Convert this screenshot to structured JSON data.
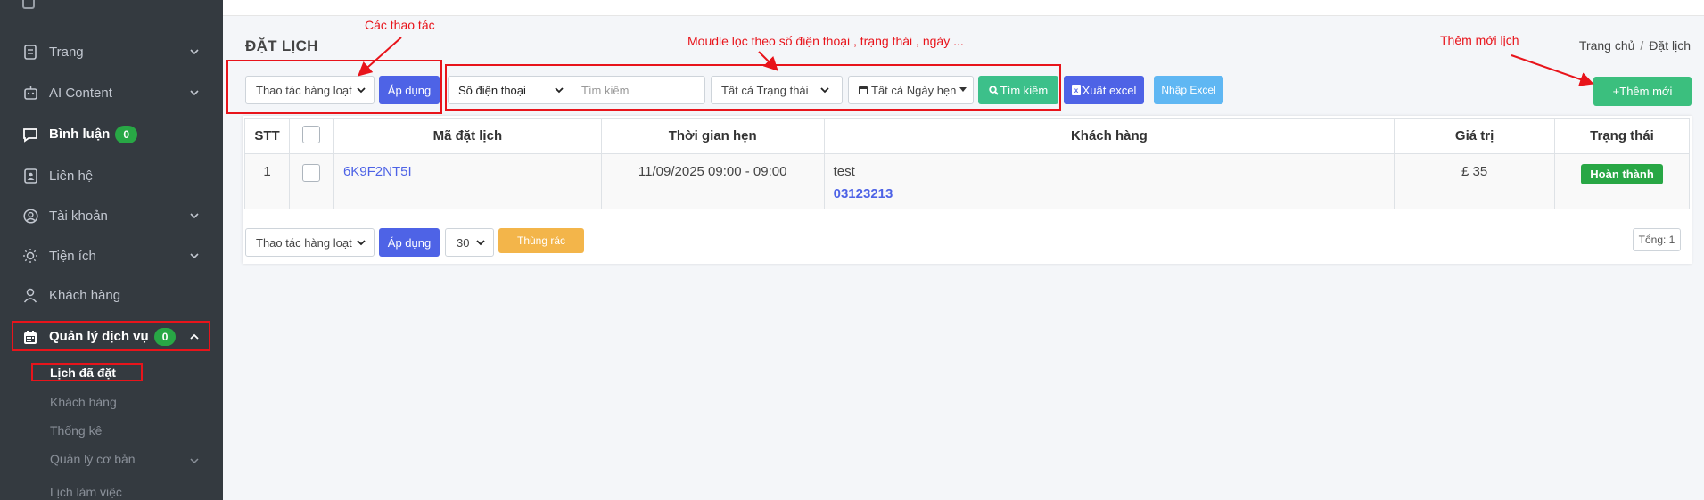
{
  "sidebar": {
    "items": [
      {
        "label": "Trang",
        "icon": "page-icon"
      },
      {
        "label": "AI Content",
        "icon": "robot-icon"
      },
      {
        "label": "Bình luận",
        "icon": "comment-icon",
        "badge": "0"
      },
      {
        "label": "Liên hệ",
        "icon": "contact-card-icon"
      },
      {
        "label": "Tài khoản",
        "icon": "user-circle-icon"
      },
      {
        "label": "Tiện ích",
        "icon": "sun-icon"
      },
      {
        "label": "Khách hàng",
        "icon": "user-icon"
      },
      {
        "label": "Quản lý dịch vụ",
        "icon": "calendar-icon",
        "badge": "0"
      }
    ],
    "subitems": [
      "Lịch đã đặt",
      "Khách hàng",
      "Thống kê",
      "Quản lý cơ bản",
      "Lịch làm việc"
    ]
  },
  "header": {
    "title": "ĐẶT LỊCH",
    "breadcrumb": [
      "Trang chủ",
      "Đặt lịch"
    ]
  },
  "toolbar": {
    "bulk_action": "Thao tác hàng loạt",
    "apply": "Áp dụng",
    "phone_select": "Số điện thoại",
    "search_placeholder": "Tìm kiếm",
    "status_select": "Tất cả Trạng thái",
    "date_select": "Tất cả Ngày hẹn",
    "search_btn": "Tìm kiếm",
    "export_btn": "Xuất excel",
    "import_btn": "Nhập Excel",
    "add_btn": "+Thêm mới"
  },
  "table": {
    "headers": [
      "STT",
      "",
      "Mã đặt lịch",
      "Thời gian hẹn",
      "Khách hàng",
      "Giá trị",
      "Trạng thái"
    ],
    "rows": [
      {
        "stt": "1",
        "code": "6K9F2NT5I",
        "time": "11/09/2025 09:00 - 09:00",
        "customer_name": "test",
        "customer_phone": "03123213",
        "value": "£ 35",
        "status": "Hoàn thành"
      }
    ]
  },
  "footer": {
    "bulk_action": "Thao tác hàng loạt",
    "apply": "Áp dụng",
    "per_page": "30",
    "trash": "Thùng rác",
    "total": "Tổng: 1"
  },
  "annotations": {
    "actions": "Các thao tác",
    "filter": "Moudle lọc theo số điện thoại , trạng thái , ngày ...",
    "add_new": "Thêm mới lịch"
  },
  "colors": {
    "sidebar_bg": "#343a40",
    "primary": "#4e63e6",
    "success": "#28a745",
    "annotation": "#e8141b"
  }
}
